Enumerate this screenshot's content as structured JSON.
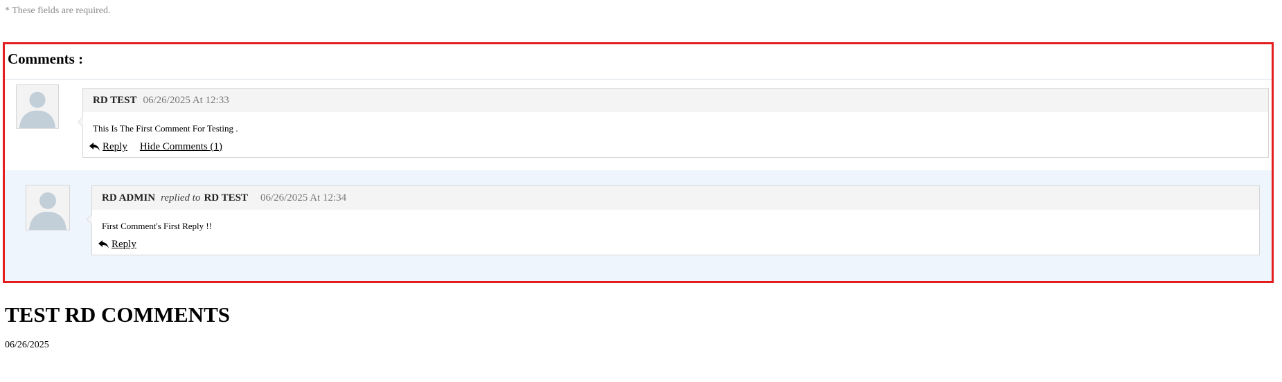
{
  "form": {
    "required_note": "* These fields are required."
  },
  "comments": {
    "title": "Comments :",
    "items": [
      {
        "author": "RD TEST",
        "date": "06/26/2025 At 12:33",
        "text": "This Is The First Comment For Testing .",
        "reply_label": "Reply",
        "hide_label": "Hide Comments (1)",
        "replies": [
          {
            "author": "RD ADMIN",
            "replied_to_label": "replied to",
            "replied_to": "RD TEST",
            "date": "06/26/2025 At 12:34",
            "text": "First Comment's First Reply !!",
            "reply_label": "Reply"
          }
        ]
      }
    ]
  },
  "post": {
    "title": "TEST RD COMMENTS",
    "date": "06/26/2025"
  },
  "colors": {
    "highlight_border": "#e41e1e",
    "reply_band": "#eef5fc",
    "comment_header": "#f4f4f4"
  },
  "icons": {
    "avatar": "user-silhouette-icon",
    "reply": "reply-arrow-icon"
  }
}
